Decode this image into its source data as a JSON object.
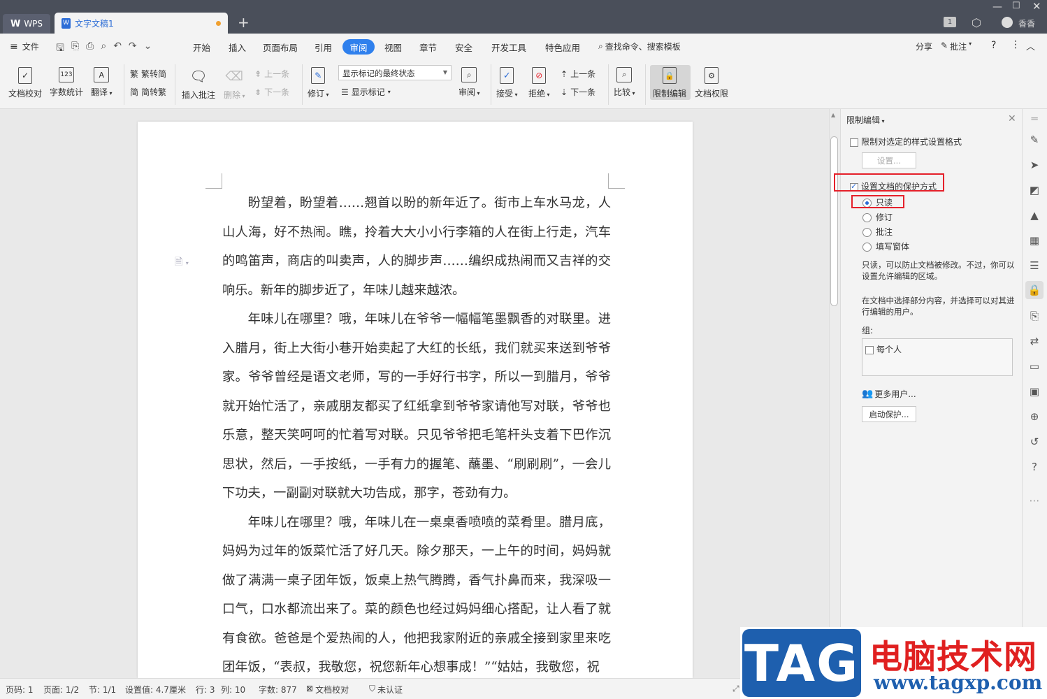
{
  "titlebar": {
    "wps_label": "WPS",
    "doc_tab": "文字文稿1",
    "add_tab": "+",
    "page_badge": "1",
    "user_name": "香香"
  },
  "menu": {
    "file": "文件",
    "items": [
      "开始",
      "插入",
      "页面布局",
      "引用",
      "审阅",
      "视图",
      "章节",
      "安全",
      "开发工具",
      "特色应用"
    ],
    "active": "审阅",
    "search": "查找命令、搜索模板",
    "share": "分享",
    "comment": "批注",
    "help": "?"
  },
  "ribbon": {
    "proofread": "文档校对",
    "word_count": "字数统计",
    "translate": "翻译",
    "trad_to_simp": "繁转简",
    "simp_to_trad": "简转繁",
    "insert_comment": "插入批注",
    "delete": "删除",
    "prev_comment": "上一条",
    "next_comment": "下一条",
    "revise": "修订",
    "markup_state": "显示标记的最终状态",
    "show_markup": "显示标记",
    "review": "审阅",
    "accept": "接受",
    "reject": "拒绝",
    "prev": "上一条",
    "next": "下一条",
    "compare": "比较",
    "restrict_edit": "限制编辑",
    "doc_permission": "文档权限"
  },
  "document": {
    "paragraphs": [
      "盼望着，盼望着……翘首以盼的新年近了。街市上车水马龙，人山人海，好不热闹。瞧，拎着大大小小行李箱的人在街上行走，汽车的鸣笛声，商店的叫卖声，人的脚步声……编织成热闹而又吉祥的交响乐。新年的脚步近了，年味儿越来越浓。",
      "年味儿在哪里？哦，年味儿在爷爷一幅幅笔墨飘香的对联里。进入腊月，街上大街小巷开始卖起了大红的长纸，我们就买来送到爷爷家。爷爷曾经是语文老师，写的一手好行书字，所以一到腊月，爷爷就开始忙活了，亲戚朋友都买了红纸拿到爷爷家请他写对联，爷爷也乐意，整天笑呵呵的忙着写对联。只见爷爷把毛笔杆头支着下巴作沉思状，然后，一手按纸，一手有力的握笔、蘸墨、“刷刷刷”，一会儿下功夫，一副副对联就大功告成，那字，苍劲有力。",
      "年味儿在哪里？哦，年味儿在一桌桌香喷喷的菜肴里。腊月底，妈妈为过年的饭菜忙活了好几天。除夕那天，一上午的时间，妈妈就做了满满一桌子团年饭，饭桌上热气腾腾，香气扑鼻而来，我深吸一口气，口水都流出来了。菜的颜色也经过妈妈细心搭配，让人看了就有食欲。爸爸是个爱热闹的人，他把我家附近的亲戚全接到家里来吃团年饭，“表叔，我敬您，祝您新年心想事成！”“姑姑，我敬您，祝"
    ]
  },
  "pane": {
    "title": "限制编辑",
    "style_restrict": "限制对选定的样式设置格式",
    "style_restrict_checked": false,
    "settings_btn": "设置...",
    "protect_mode": "设置文档的保护方式",
    "protect_mode_checked": true,
    "options": [
      "只读",
      "修订",
      "批注",
      "填写窗体"
    ],
    "selected_option": "只读",
    "desc1": "只读，可以防止文档被修改。不过，你可以设置允许编辑的区域。",
    "desc2": "在文档中选择部分内容，并选择可以对其进行编辑的用户。",
    "group_label": "组:",
    "everyone": "每个人",
    "more_users": "更多用户...",
    "start_protect": "启动保护..."
  },
  "statusbar": {
    "page_num": "页码: 1",
    "pages": "页面: 1/2",
    "section": "节: 1/1",
    "setting": "设置值: 4.7厘米",
    "row": "行: 3",
    "col": "列: 10",
    "words": "字数: 877",
    "proof": "文档校对",
    "auth": "未认证"
  },
  "watermark": {
    "tag": "TAG",
    "title": "电脑技术网",
    "url": "www.tagxp.com"
  },
  "colors": {
    "accent": "#2f80ed",
    "highlight_box": "#e5202a",
    "titlebar": "#4a4f5a"
  }
}
